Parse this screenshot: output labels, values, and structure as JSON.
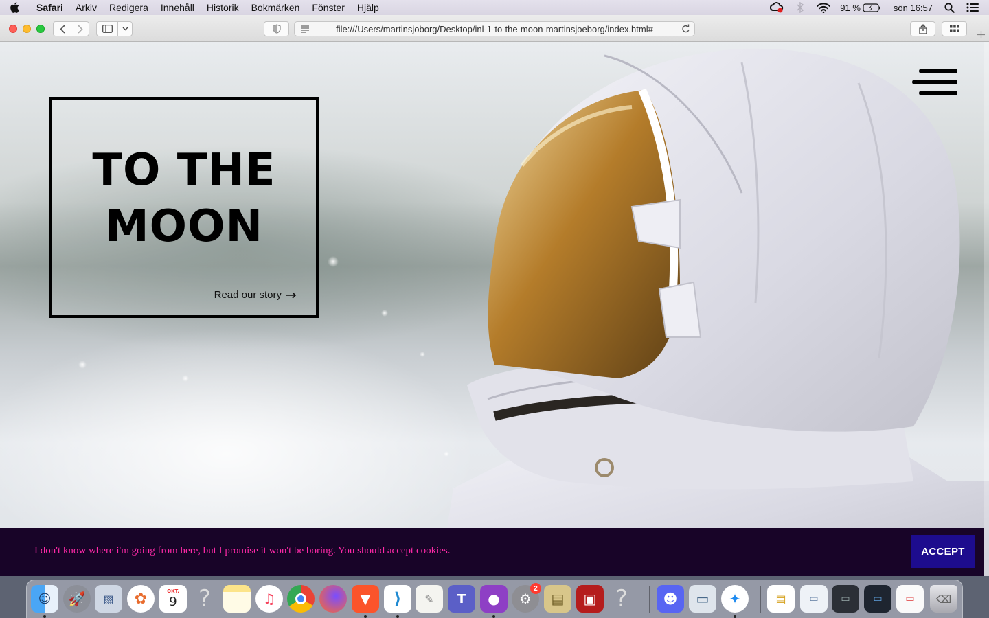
{
  "menubar": {
    "app_name": "Safari",
    "items": [
      "Arkiv",
      "Redigera",
      "Innehåll",
      "Historik",
      "Bokmärken",
      "Fönster",
      "Hjälp"
    ],
    "battery": "91 %",
    "clock": "sön 16:57"
  },
  "browser": {
    "url": "file:///Users/martinsjoborg/Desktop/inl-1-to-the-moon-martinsjoeborg/index.html#"
  },
  "page": {
    "hero_title_line1": "TO THE",
    "hero_title_line2": "MOON",
    "hero_link": "Read our story",
    "cookie_text": "I don't know where i'm going from here, but I promise it won't be boring. You should accept cookies.",
    "accept_label": "ACCEPT"
  },
  "dock": {
    "apps": [
      "Finder",
      "Launchpad",
      "Preview",
      "Photos",
      "Calendar",
      "Unknown",
      "Notes",
      "Music",
      "Chrome",
      "Firefox",
      "Brave",
      "VS Code",
      "TextEdit",
      "Teams",
      "GitHub Desktop",
      "System Preferences",
      "Archive Utility",
      "Photo Booth",
      "Unknown",
      "Discord",
      "Image Capture",
      "Safari",
      "Document",
      "Window",
      "Window",
      "Window",
      "Window",
      "Trash"
    ],
    "calendar_month": "OKT.",
    "calendar_day": "9",
    "system_prefs_badge": "2"
  },
  "colors": {
    "cookie_background": "#180428",
    "cookie_text": "#ff2aa8",
    "accept_background": "#1d0c8e"
  }
}
